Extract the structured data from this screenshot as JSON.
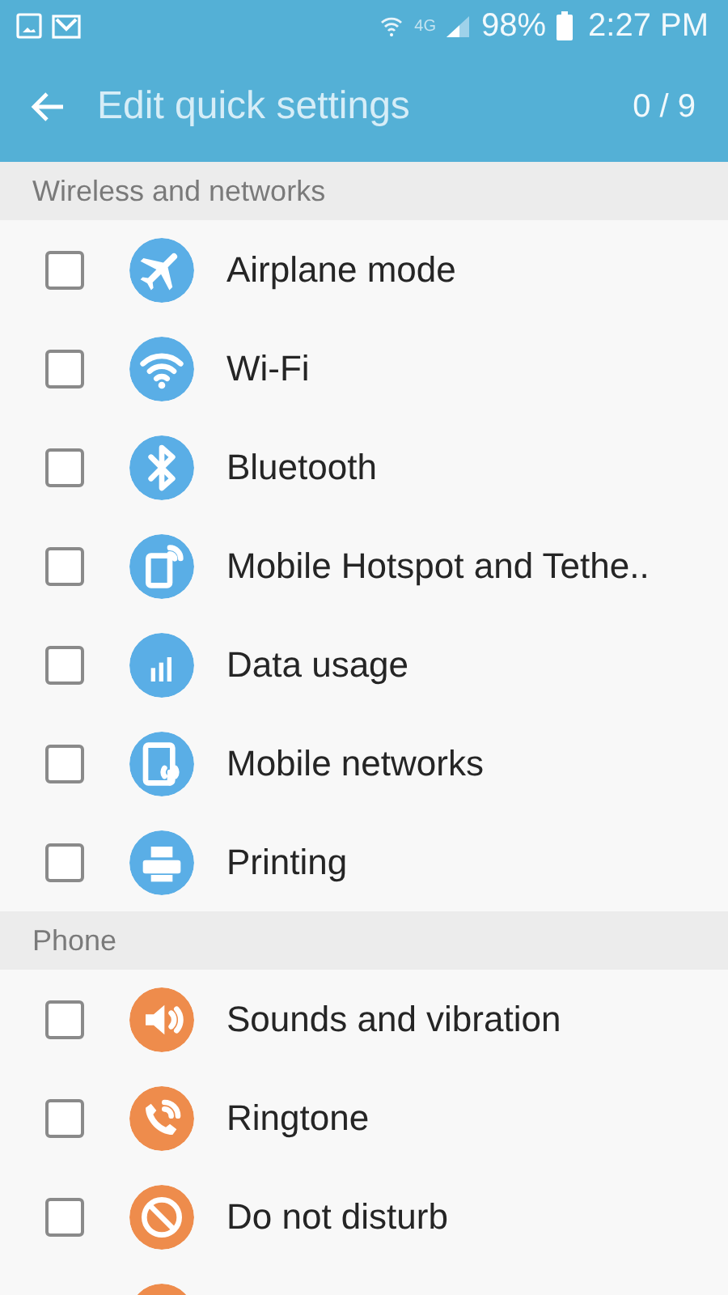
{
  "status_bar": {
    "network": "4G",
    "battery": "98%",
    "time": "2:27 PM"
  },
  "app_bar": {
    "title": "Edit quick settings",
    "count": "0 / 9"
  },
  "sections": [
    {
      "title": "Wireless and networks",
      "items": [
        {
          "label": "Airplane mode",
          "kind": "airplane",
          "color": "#5aaee6",
          "checked": false
        },
        {
          "label": "Wi-Fi",
          "kind": "wifi",
          "color": "#5aaee6",
          "checked": false
        },
        {
          "label": "Bluetooth",
          "kind": "bluetooth",
          "color": "#5aaee6",
          "checked": false
        },
        {
          "label": "Mobile Hotspot and Tethe..",
          "kind": "hotspot",
          "color": "#5aaee6",
          "checked": false
        },
        {
          "label": "Data usage",
          "kind": "data",
          "color": "#5aaee6",
          "checked": false
        },
        {
          "label": "Mobile networks",
          "kind": "network",
          "color": "#5aaee6",
          "checked": false
        },
        {
          "label": "Printing",
          "kind": "printer",
          "color": "#5aaee6",
          "checked": false
        }
      ]
    },
    {
      "title": "Phone",
      "items": [
        {
          "label": "Sounds and vibration",
          "kind": "sound",
          "color": "#ee8c4c",
          "checked": false
        },
        {
          "label": "Ringtone",
          "kind": "ringtone",
          "color": "#ee8c4c",
          "checked": false
        },
        {
          "label": "Do not disturb",
          "kind": "block",
          "color": "#ee8c4c",
          "checked": false
        },
        {
          "kind": "generic",
          "color": "#ee8c4c"
        }
      ]
    }
  ]
}
